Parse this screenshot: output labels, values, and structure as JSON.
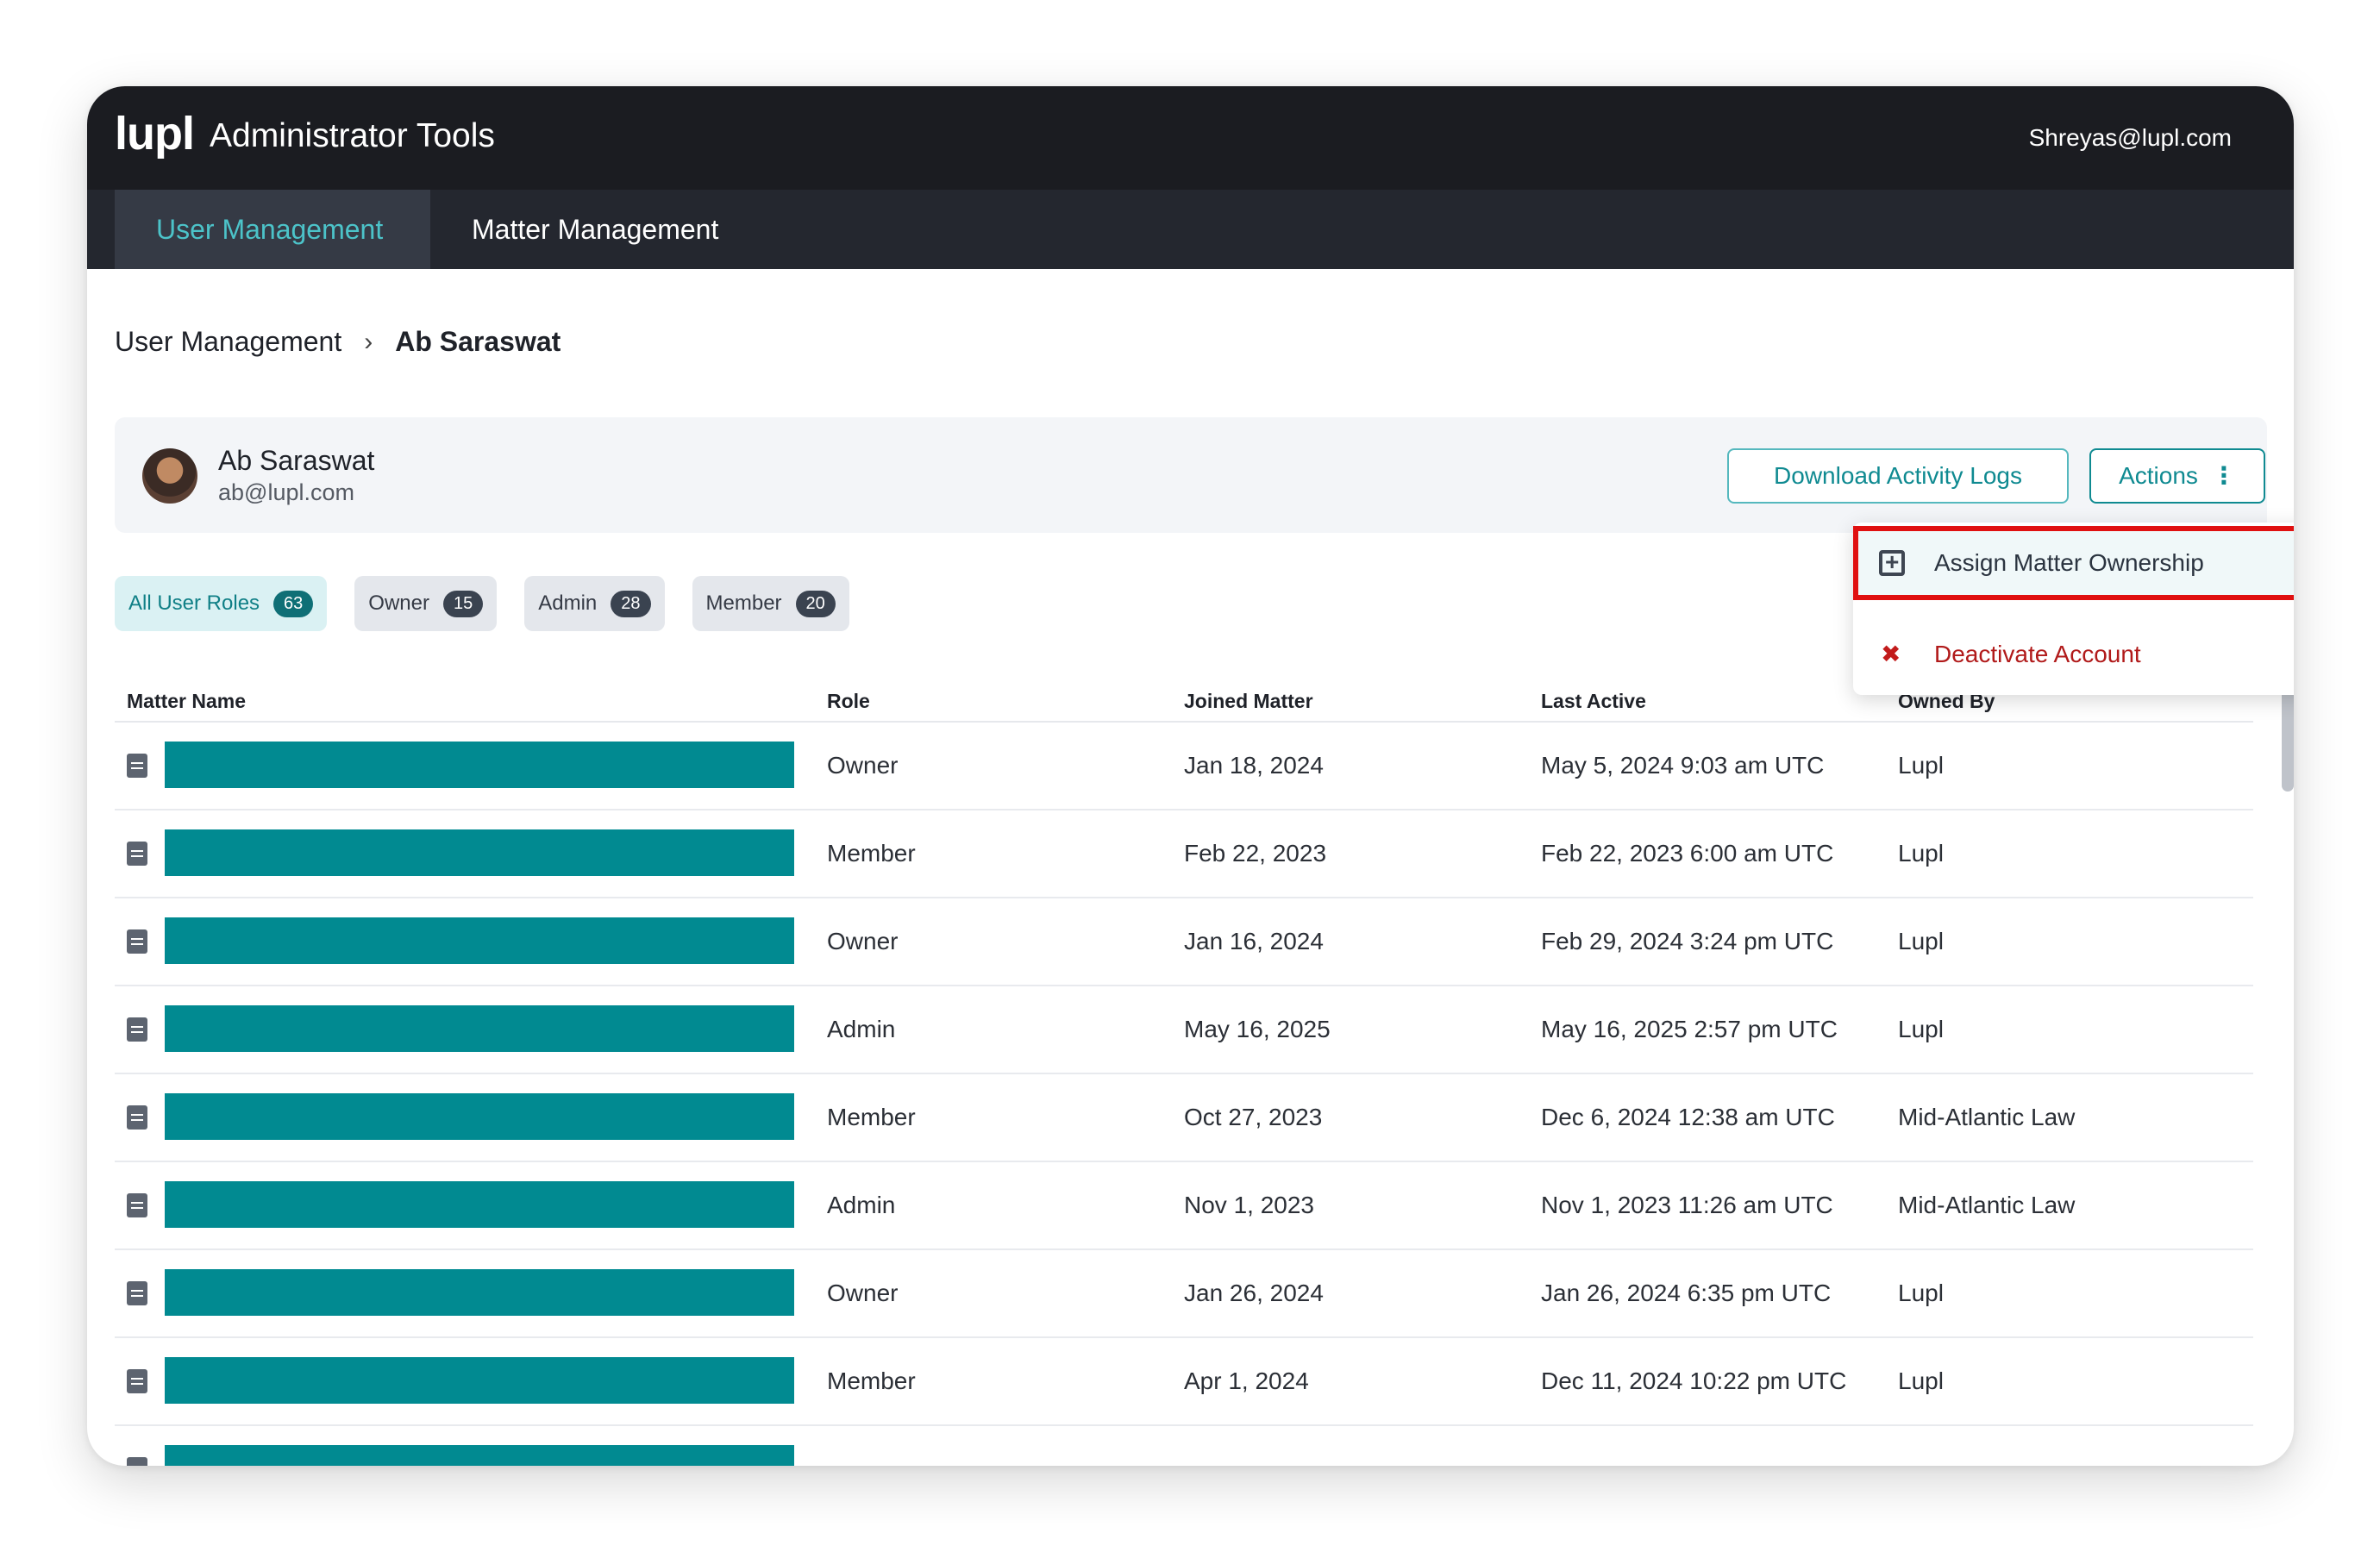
{
  "header": {
    "logo": "lupl",
    "app_title": "Administrator Tools",
    "user_email": "Shreyas@lupl.com"
  },
  "tabs": [
    {
      "label": "User Management",
      "active": true
    },
    {
      "label": "Matter Management",
      "active": false
    }
  ],
  "breadcrumb": {
    "parent": "User Management",
    "separator": "›",
    "current": "Ab Saraswat"
  },
  "user": {
    "name": "Ab Saraswat",
    "email": "ab@lupl.com"
  },
  "buttons": {
    "download": "Download Activity Logs",
    "actions": "Actions",
    "actions_icon": "⋮"
  },
  "dropdown": {
    "assign": "Assign Matter Ownership",
    "deactivate": "Deactivate Account"
  },
  "filters": [
    {
      "label": "All User Roles",
      "count": "63",
      "active": true
    },
    {
      "label": "Owner",
      "count": "15",
      "active": false
    },
    {
      "label": "Admin",
      "count": "28",
      "active": false
    },
    {
      "label": "Member",
      "count": "20",
      "active": false
    }
  ],
  "table": {
    "headers": {
      "matter": "Matter Name",
      "role": "Role",
      "joined": "Joined Matter",
      "last": "Last Active",
      "owned": "Owned By"
    },
    "rows": [
      {
        "role": "Owner",
        "joined": "Jan 18, 2024",
        "last": "May 5, 2024 9:03 am UTC",
        "owned": "Lupl"
      },
      {
        "role": "Member",
        "joined": "Feb 22, 2023",
        "last": "Feb 22, 2023 6:00 am UTC",
        "owned": "Lupl"
      },
      {
        "role": "Owner",
        "joined": "Jan 16, 2024",
        "last": "Feb 29, 2024 3:24 pm UTC",
        "owned": "Lupl"
      },
      {
        "role": "Admin",
        "joined": "May 16, 2025",
        "last": "May 16, 2025 2:57 pm UTC",
        "owned": "Lupl"
      },
      {
        "role": "Member",
        "joined": "Oct 27, 2023",
        "last": "Dec 6, 2024 12:38 am UTC",
        "owned": "Mid-Atlantic Law"
      },
      {
        "role": "Admin",
        "joined": "Nov 1, 2023",
        "last": "Nov 1, 2023 11:26 am UTC",
        "owned": "Mid-Atlantic Law"
      },
      {
        "role": "Owner",
        "joined": "Jan 26, 2024",
        "last": "Jan 26, 2024 6:35 pm UTC",
        "owned": "Lupl"
      },
      {
        "role": "Member",
        "joined": "Apr 1, 2024",
        "last": "Dec 11, 2024 10:22 pm UTC",
        "owned": "Lupl"
      }
    ]
  }
}
